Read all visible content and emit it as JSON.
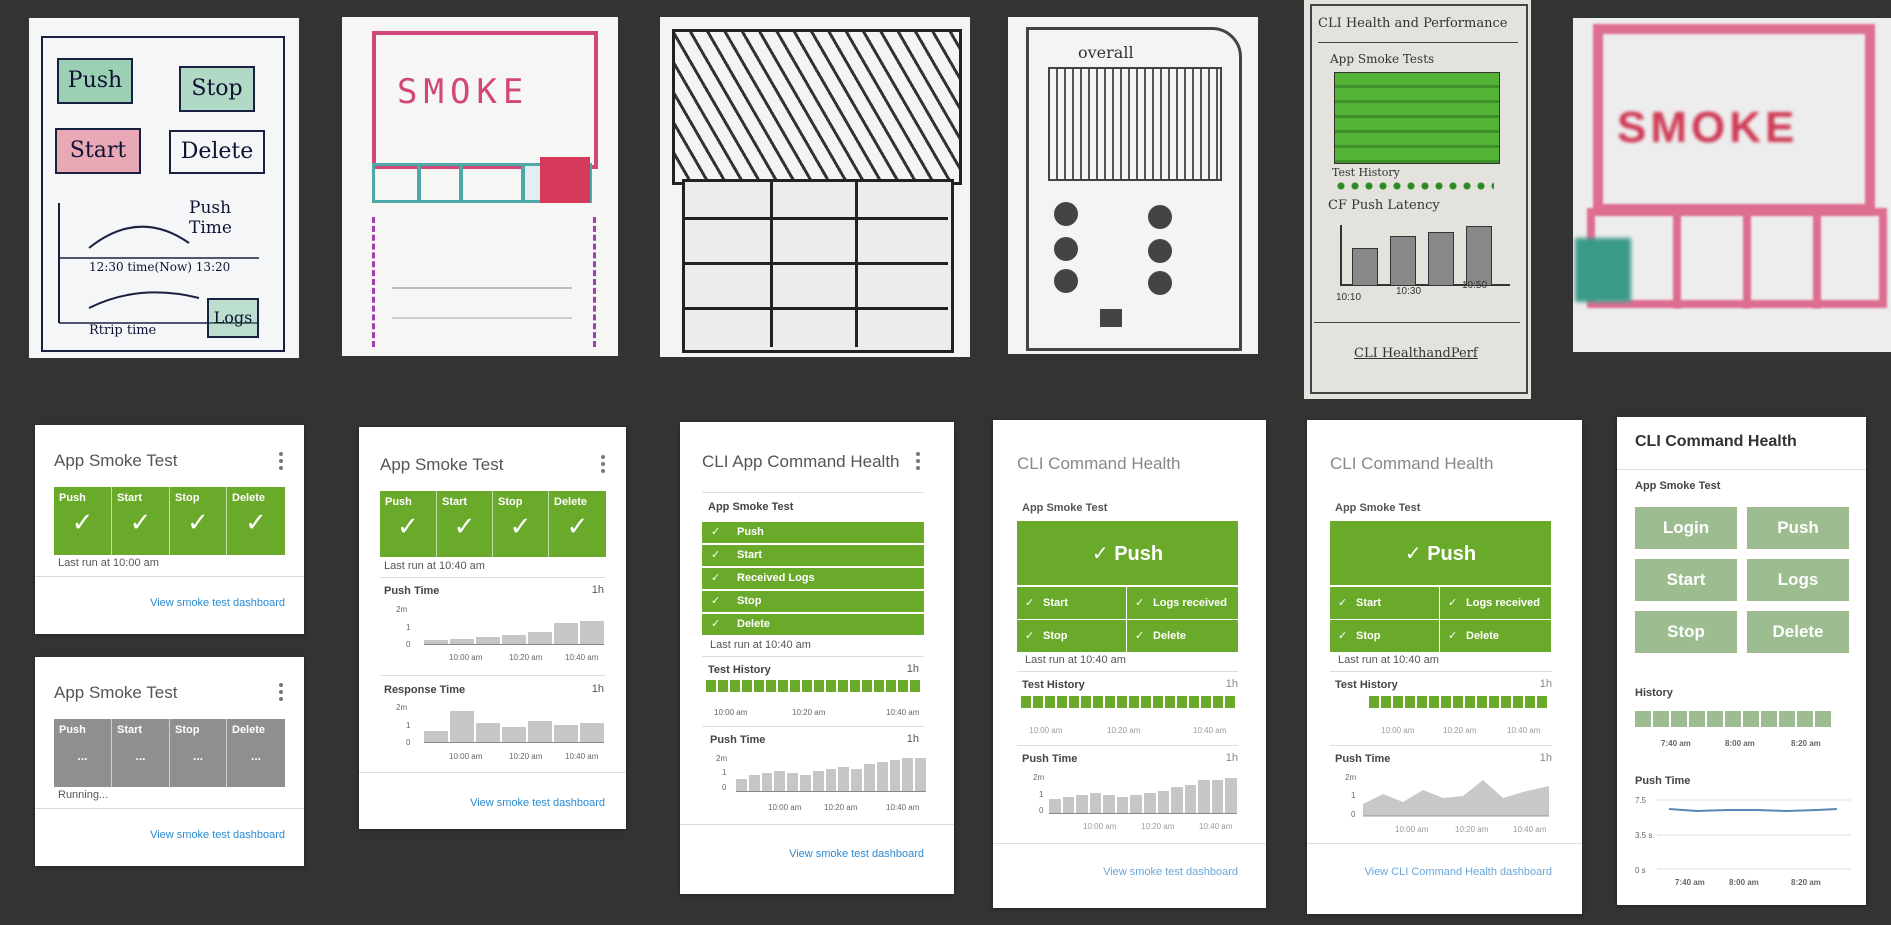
{
  "sketches": {
    "s1": {
      "push": "Push",
      "stop": "Stop",
      "start": "Start",
      "delete": "Delete",
      "push_time": "Push\nTime",
      "times": "12:30 time(Now) 13:20",
      "trip": "Rtrip time",
      "logs": "Logs"
    },
    "s2": {
      "smoke": "SMOKE"
    },
    "s4": {
      "overall": "overall"
    },
    "s5": {
      "title": "CLI Health and Performance",
      "smoke": "App Smoke Tests",
      "history": "Test History",
      "latency": "CF Push Latency",
      "t1": "10:10",
      "t2": "10:30",
      "t3": "10:50",
      "footer": "CLI HealthandPerf"
    },
    "s6": {
      "smoke": "SMOKE"
    }
  },
  "card1": {
    "title": "App Smoke Test",
    "cells": [
      "Push",
      "Start",
      "Stop",
      "Delete"
    ],
    "check": "✓",
    "status": "Last run at 10:00 am",
    "link": "View smoke test dashboard"
  },
  "card1b": {
    "title": "App Smoke Test",
    "cells": [
      "Push",
      "Start",
      "Stop",
      "Delete"
    ],
    "dots": "...",
    "status": "Running...",
    "link": "View smoke test dashboard"
  },
  "card2": {
    "title": "App Smoke Test",
    "cells": [
      "Push",
      "Start",
      "Stop",
      "Delete"
    ],
    "check": "✓",
    "status": "Last run at 10:40 am",
    "push_time": "Push Time",
    "response_time": "Response Time",
    "range": "1h",
    "y": [
      "2m",
      "1",
      "0"
    ],
    "x": [
      "10:00 am",
      "10:20 am",
      "10:40 am"
    ],
    "link": "View smoke test dashboard"
  },
  "card3": {
    "title": "CLI App Command  Health",
    "section": "App Smoke Test",
    "rows": [
      "Push",
      "Start",
      "Received Logs",
      "Stop",
      "Delete"
    ],
    "status": "Last run at 10:40 am",
    "history": "Test History",
    "push_time": "Push Time",
    "range": "1h",
    "y": [
      "2m",
      "1",
      "0"
    ],
    "x": [
      "10:00 am",
      "10:20 am",
      "10:40 am"
    ],
    "link": "View smoke test dashboard"
  },
  "card4": {
    "title": "CLI Command Health",
    "section": "App Smoke Test",
    "push": "Push",
    "items": [
      "Start",
      "Logs received",
      "Stop",
      "Delete"
    ],
    "status": "Last run at 10:40 am",
    "history": "Test History",
    "push_time": "Push Time",
    "range": "1h",
    "y": [
      "2m",
      "1",
      "0"
    ],
    "x": [
      "10:00 am",
      "10:20 am",
      "10:40 am"
    ],
    "link": "View smoke test dashboard"
  },
  "card5": {
    "title": "CLI Command Health",
    "section": "App Smoke Test",
    "push": "Push",
    "items": [
      "Start",
      "Logs received",
      "Stop",
      "Delete"
    ],
    "status": "Last run at 10:40 am",
    "history": "Test History",
    "push_time": "Push Time",
    "range": "1h",
    "y": [
      "2m",
      "1",
      "0"
    ],
    "x": [
      "10:00 am",
      "10:20 am",
      "10:40 am"
    ],
    "link": "View CLI Command Health dashboard"
  },
  "card6": {
    "title": "CLI Command Health",
    "section": "App Smoke Test",
    "buttons": [
      "Login",
      "Push",
      "Start",
      "Logs",
      "Stop",
      "Delete"
    ],
    "history": "History",
    "push_time": "Push Time",
    "x": [
      "7:40 am",
      "8:00 am",
      "8:20 am"
    ],
    "y": [
      "7.5",
      "3.5 s",
      "0 s"
    ]
  },
  "chart_data": [
    {
      "type": "bar",
      "title": "Push Time",
      "values": [
        0.25,
        0.3,
        0.4,
        0.5,
        0.65,
        1.1,
        1.2
      ],
      "ylim": [
        0,
        2
      ]
    },
    {
      "type": "bar",
      "title": "Response Time",
      "values": [
        0.6,
        1.6,
        1.0,
        0.8,
        1.1,
        0.9,
        1.0
      ],
      "ylim": [
        0,
        2
      ]
    },
    {
      "type": "bar",
      "title": "Push Time",
      "values": [
        0.7,
        0.9,
        1.0,
        1.1,
        1.0,
        0.9,
        1.1,
        1.2,
        1.3,
        1.2,
        1.5,
        1.6,
        1.7,
        1.8,
        1.8
      ],
      "ylim": [
        0,
        2
      ]
    },
    {
      "type": "bar",
      "title": "Push Time",
      "values": [
        0.7,
        0.8,
        0.9,
        1.0,
        0.9,
        0.8,
        0.9,
        1.0,
        1.1,
        1.3,
        1.4,
        1.6,
        1.6,
        1.7
      ],
      "ylim": [
        0,
        2
      ]
    }
  ],
  "colors": {
    "background": "#333333",
    "success": "#6aaa2a",
    "pending": "#8f8f8f",
    "link": "#2a8ad4",
    "muted_green": "#9dbd91"
  }
}
